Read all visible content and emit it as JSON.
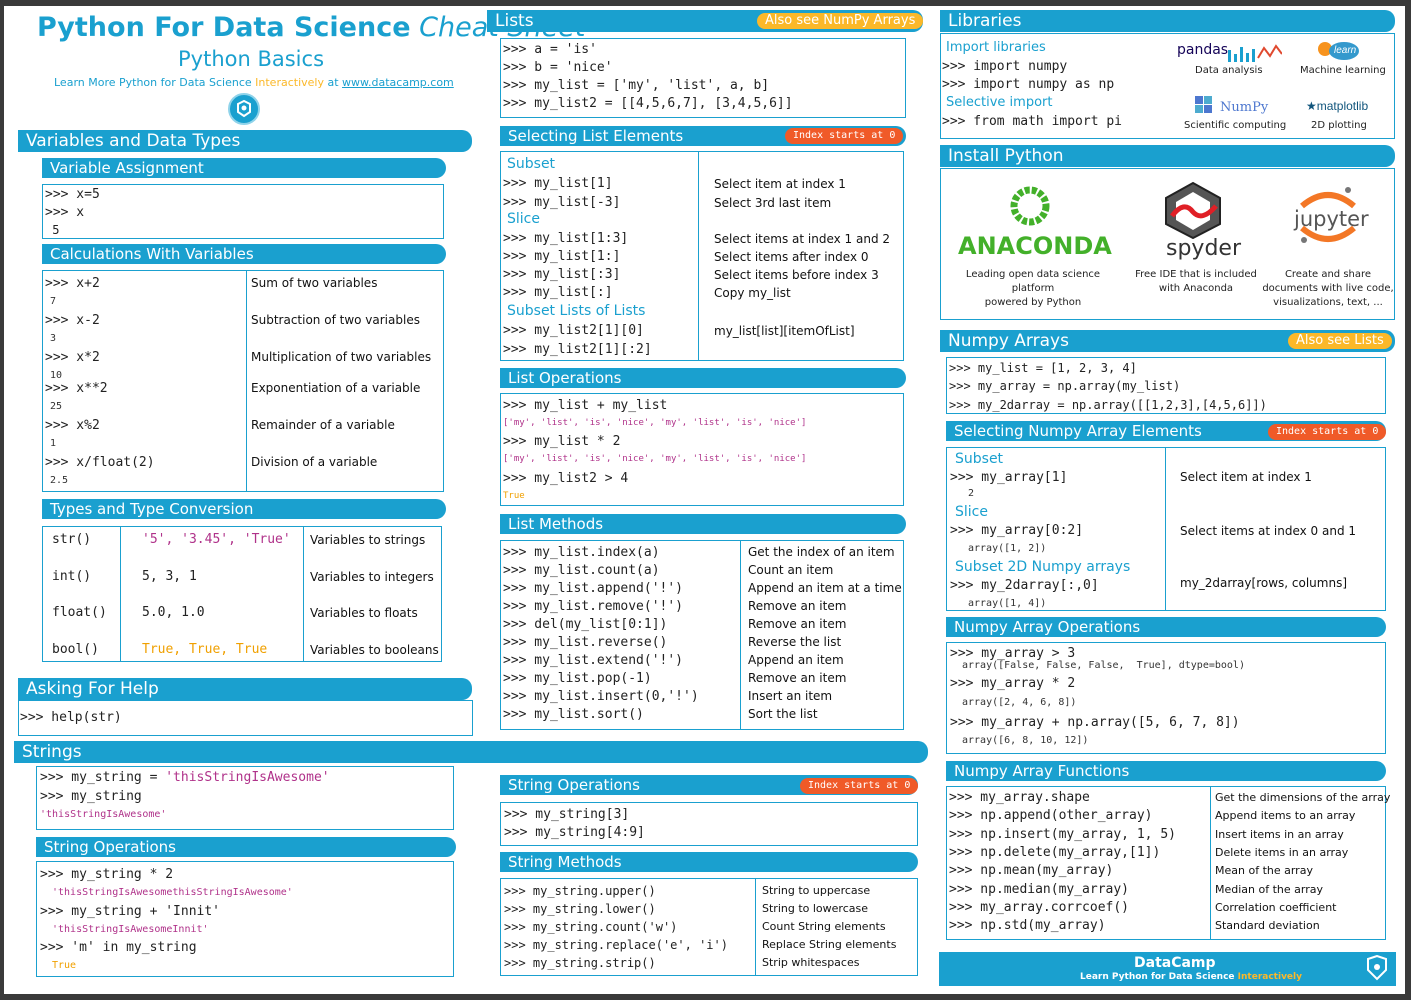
{
  "title": {
    "bold": "Python For Data Science",
    "italic": "Cheat Sheet",
    "subtitle": "Python Basics",
    "learn_pre": "Learn More Python for Data Science ",
    "learn_inter": "Interactively",
    "learn_at": " at ",
    "link": "www.datacamp.com"
  },
  "vars": {
    "header": "Variables and Data Types",
    "assign_header": "Variable Assignment",
    "assign_lines": [
      ">>> x=5",
      ">>> x",
      " 5"
    ],
    "calc_header": "Calculations With Variables",
    "calc": [
      {
        "code": ">>> x+2",
        "out": "7",
        "desc": "Sum of two variables"
      },
      {
        "code": ">>> x-2",
        "out": "3",
        "desc": "Subtraction of two variables"
      },
      {
        "code": ">>> x*2",
        "out": "10",
        "desc": "Multiplication of two variables"
      },
      {
        "code": ">>> x**2",
        "out": "25",
        "desc": "Exponentiation of a variable"
      },
      {
        "code": ">>> x%2",
        "out": "1",
        "desc": "Remainder of a variable"
      },
      {
        "code": ">>> x/float(2)",
        "out": "2.5",
        "desc": "Division of a variable"
      }
    ],
    "types_header": "Types and Type Conversion",
    "types": [
      {
        "fn": "str()",
        "ex": "'5', '3.45', 'True'",
        "desc": "Variables to strings"
      },
      {
        "fn": "int()",
        "ex": "5, 3, 1",
        "desc": "Variables to integers"
      },
      {
        "fn": "float()",
        "ex": "5.0, 1.0",
        "desc": "Variables to floats"
      },
      {
        "fn": "bool()",
        "ex": "True, True, True",
        "desc": "Variables to booleans"
      }
    ]
  },
  "help": {
    "header": "Asking For Help",
    "code": ">>> help(str)"
  },
  "lists": {
    "header": "Lists",
    "tag": "Also see NumPy Arrays",
    "init": [
      ">>> a = 'is'",
      ">>> b = 'nice'",
      ">>> my_list = ['my', 'list', a, b]",
      ">>> my_list2 = [[4,5,6,7], [3,4,5,6]]"
    ],
    "select_header": "Selecting List Elements",
    "select_tag": "Index starts at 0",
    "subset": "Subset",
    "slice": "Slice",
    "subset_lists": "Subset Lists of Lists",
    "sel": [
      {
        "code": ">>> my_list[1]",
        "desc": "Select item at index 1"
      },
      {
        "code": ">>> my_list[-3]",
        "desc": "Select 3rd last item"
      },
      {
        "code": ">>> my_list[1:3]",
        "desc": "Select items at index 1 and 2"
      },
      {
        "code": ">>> my_list[1:]",
        "desc": "Select items after index 0"
      },
      {
        "code": ">>> my_list[:3]",
        "desc": "Select items before index 3"
      },
      {
        "code": ">>> my_list[:]",
        "desc": "Copy my_list"
      },
      {
        "code": ">>> my_list2[1][0]",
        "desc": "my_list[list][itemOfList]"
      },
      {
        "code": ">>> my_list2[1][:2]",
        "desc": ""
      }
    ],
    "ops_header": "List Operations",
    "ops": [
      {
        "code": ">>> my_list + my_list",
        "out": "['my', 'list', 'is', 'nice', 'my', 'list', 'is', 'nice']"
      },
      {
        "code": ">>> my_list * 2",
        "out": "['my', 'list', 'is', 'nice', 'my', 'list', 'is', 'nice']"
      },
      {
        "code": ">>> my_list2 > 4",
        "out": "True"
      }
    ],
    "methods_header": "List Methods",
    "methods": [
      {
        "code": ">>> my_list.index(a)",
        "desc": "Get the index of an item"
      },
      {
        "code": ">>> my_list.count(a)",
        "desc": "Count an item"
      },
      {
        "code": ">>> my_list.append('!')",
        "desc": "Append an item at a time"
      },
      {
        "code": ">>> my_list.remove('!')",
        "desc": "Remove an item"
      },
      {
        "code": ">>> del(my_list[0:1])",
        "desc": "Remove an item"
      },
      {
        "code": ">>> my_list.reverse()",
        "desc": "Reverse the list"
      },
      {
        "code": ">>> my_list.extend('!')",
        "desc": "Append an item"
      },
      {
        "code": ">>> my_list.pop(-1)",
        "desc": "Remove an item"
      },
      {
        "code": ">>> my_list.insert(0,'!')",
        "desc": "Insert an item"
      },
      {
        "code": ">>> my_list.sort()",
        "desc": "Sort the list"
      }
    ]
  },
  "strings": {
    "header": "Strings",
    "init": [
      ">>> my_string = 'thisStringIsAwesome'",
      ">>> my_string"
    ],
    "init_out": "'thisStringIsAwesome'",
    "ops_header": "String Operations",
    "ops": [
      {
        "code": ">>> my_string * 2",
        "out": "'thisStringIsAwesomethisStringIsAwesome'"
      },
      {
        "code": ">>> my_string + 'Innit'",
        "out": "'thisStringIsAwesomeInnit'"
      },
      {
        "code": ">>> 'm' in my_string",
        "out": "True"
      }
    ],
    "ops2_header": "String Operations",
    "ops2_tag": "Index starts at 0",
    "ops2": [
      ">>> my_string[3]",
      ">>> my_string[4:9]"
    ],
    "methods_header": "String Methods",
    "methods": [
      {
        "code": ">>> my_string.upper()",
        "desc": "String to uppercase"
      },
      {
        "code": ">>> my_string.lower()",
        "desc": "String to lowercase"
      },
      {
        "code": ">>> my_string.count('w')",
        "desc": "Count String elements"
      },
      {
        "code": ">>> my_string.replace('e', 'i')",
        "desc": "Replace String elements"
      },
      {
        "code": ">>> my_string.strip()",
        "desc": "Strip whitespaces"
      }
    ]
  },
  "libs": {
    "header": "Libraries",
    "import_header": "Import libraries",
    "import": [
      ">>> import numpy",
      ">>> import numpy as np"
    ],
    "selective_header": "Selective import",
    "selective": ">>> from math import pi",
    "items": [
      {
        "name": "pandas",
        "desc": "Data analysis"
      },
      {
        "name": "learn",
        "desc": "Machine learning"
      },
      {
        "name": "NumPy",
        "desc": "Scientific computing"
      },
      {
        "name": "matplotlib",
        "desc": "2D plotting"
      }
    ]
  },
  "install": {
    "header": "Install Python",
    "items": [
      {
        "name": "ANACONDA",
        "desc": "Leading open data science platform\npowered by Python"
      },
      {
        "name": "spyder",
        "desc": "Free IDE that is included\nwith Anaconda"
      },
      {
        "name": "jupyter",
        "desc": "Create and share\ndocuments with live code,\nvisualizations, text, ..."
      }
    ]
  },
  "numpy": {
    "header": "Numpy Arrays",
    "tag": "Also see Lists",
    "init": [
      ">>> my_list = [1, 2, 3, 4]",
      ">>> my_array = np.array(my_list)",
      ">>> my_2darray = np.array([[1,2,3],[4,5,6]])"
    ],
    "select_header": "Selecting Numpy Array Elements",
    "select_tag": "Index starts at 0",
    "subset": "Subset",
    "slice": "Slice",
    "subset2d": "Subset 2D Numpy arrays",
    "sel": [
      {
        "code": ">>> my_array[1]",
        "out": "2",
        "desc": "Select item at index 1"
      },
      {
        "code": ">>> my_array[0:2]",
        "out": "array([1, 2])",
        "desc": "Select items at index 0 and 1"
      },
      {
        "code": ">>> my_2darray[:,0]",
        "out": "array([1, 4])",
        "desc": "my_2darray[rows, columns]"
      }
    ],
    "ops_header": "Numpy Array Operations",
    "ops": [
      {
        "code": ">>> my_array > 3",
        "out": "array([False, False, False,  True], dtype=bool)"
      },
      {
        "code": ">>> my_array * 2",
        "out": "array([2, 4, 6, 8])"
      },
      {
        "code": ">>> my_array + np.array([5, 6, 7, 8])",
        "out": "array([6, 8, 10, 12])"
      }
    ],
    "funcs_header": "Numpy Array Functions",
    "funcs": [
      {
        "code": ">>> my_array.shape",
        "desc": "Get the dimensions of the array"
      },
      {
        "code": ">>> np.append(other_array)",
        "desc": "Append items to an array"
      },
      {
        "code": ">>> np.insert(my_array, 1, 5)",
        "desc": "Insert items in an array"
      },
      {
        "code": ">>> np.delete(my_array,[1])",
        "desc": "Delete items in an array"
      },
      {
        "code": ">>> np.mean(my_array)",
        "desc": "Mean of the array"
      },
      {
        "code": ">>> np.median(my_array)",
        "desc": "Median of the array"
      },
      {
        "code": ">>> my_array.corrcoef()",
        "desc": "Correlation coefficient"
      },
      {
        "code": ">>> np.std(my_array)",
        "desc": "Standard deviation"
      }
    ]
  },
  "footer": {
    "brand": "DataCamp",
    "tag_pre": "Learn Python for Data Science ",
    "tag_inter": "Interactively"
  }
}
